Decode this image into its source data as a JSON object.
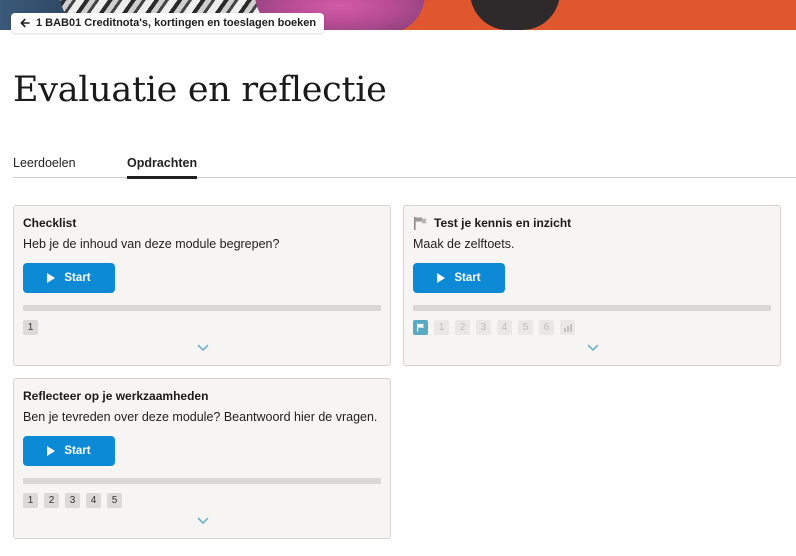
{
  "back_link": {
    "label": "1 BAB01 Creditnota's, kortingen en toeslagen boeken",
    "icon": "arrow-left-icon"
  },
  "page": {
    "title": "Evaluatie en reflectie"
  },
  "tabs": [
    {
      "label": "Leerdoelen",
      "active": false
    },
    {
      "label": "Opdrachten",
      "active": true
    }
  ],
  "cards": [
    {
      "title": "Checklist",
      "description": "Heb je de inhoud van deze module begrepen?",
      "button": "Start",
      "steps": [
        "1"
      ]
    },
    {
      "title": "Test je kennis en inzicht",
      "title_icon": "flag-icon",
      "description": "Maak de zelftoets.",
      "button": "Start",
      "steps": [
        "1",
        "2",
        "3",
        "4",
        "5",
        "6"
      ]
    },
    {
      "title": "Reflecteer op je werkzaamheden",
      "description": "Ben je tevreden over deze module? Beantwoord hier de vragen.",
      "button": "Start",
      "steps": [
        "1",
        "2",
        "3",
        "4",
        "5"
      ]
    }
  ],
  "colors": {
    "accent": "#0d8ad6",
    "card_bg": "#f6f5f3",
    "flag_step": "#5aa9c2",
    "chevron": "#6fb3cf"
  }
}
